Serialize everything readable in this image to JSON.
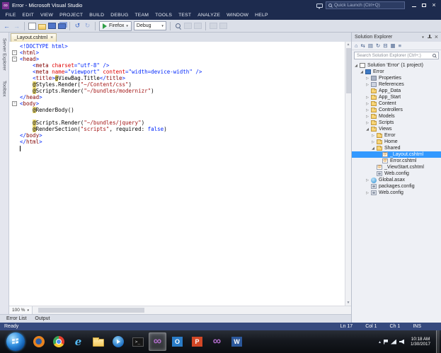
{
  "window": {
    "title": "Error - Microsoft Visual Studio",
    "quick_launch": "Quick Launch (Ctrl+Q)"
  },
  "menu": [
    "FILE",
    "EDIT",
    "VIEW",
    "PROJECT",
    "BUILD",
    "DEBUG",
    "TEAM",
    "TOOLS",
    "TEST",
    "ANALYZE",
    "WINDOW",
    "HELP"
  ],
  "toolbar": {
    "items": [
      {
        "type": "icon",
        "name": "navigate-back-icon",
        "glyph": "←"
      },
      {
        "type": "icon",
        "name": "navigate-forward-icon",
        "glyph": "→",
        "dim": true
      },
      {
        "type": "sep"
      },
      {
        "type": "icon",
        "name": "new-file-icon",
        "cls": "i-page"
      },
      {
        "type": "icon",
        "name": "open-file-icon",
        "cls": "i-folder"
      },
      {
        "type": "icon",
        "name": "save-icon",
        "cls": "i-save"
      },
      {
        "type": "icon",
        "name": "save-all-icon",
        "cls": "i-saveall"
      },
      {
        "type": "sep"
      },
      {
        "type": "icon",
        "name": "undo-icon",
        "glyph": "↺"
      },
      {
        "type": "icon",
        "name": "redo-icon",
        "glyph": "↻",
        "dim": true
      },
      {
        "type": "sep"
      },
      {
        "type": "run",
        "label": "Firefox"
      },
      {
        "type": "dropdown",
        "name": "solution-configurations-dropdown",
        "label": "Debug"
      },
      {
        "type": "sep"
      },
      {
        "type": "icon",
        "name": "find-in-files-icon",
        "cls": "i-mag"
      },
      {
        "type": "icon",
        "name": "comment-out-icon",
        "cls": "i-sq",
        "dim": true
      },
      {
        "type": "icon",
        "name": "uncomment-icon",
        "cls": "i-sq",
        "dim": true
      },
      {
        "type": "sep"
      },
      {
        "type": "icon",
        "name": "toggle-bookmark-icon",
        "cls": "i-sq",
        "dim": true
      },
      {
        "type": "icon",
        "name": "next-bookmark-icon",
        "cls": "i-sq",
        "dim": true
      }
    ]
  },
  "left_tabs": [
    "Server Explorer",
    "Toolbox"
  ],
  "editor": {
    "tab": "_Layout.cshtml",
    "zoom": "100 %",
    "code_lines": [
      {
        "tokens": [
          {
            "t": "<!DOCTYPE html>",
            "c": "b"
          }
        ]
      },
      {
        "fold": true,
        "tokens": [
          {
            "t": "<",
            "c": "b"
          },
          {
            "t": "html",
            "c": "m"
          },
          {
            "t": ">",
            "c": "b"
          }
        ]
      },
      {
        "fold": true,
        "tokens": [
          {
            "t": "<",
            "c": "b"
          },
          {
            "t": "head",
            "c": "m"
          },
          {
            "t": ">",
            "c": "b"
          }
        ]
      },
      {
        "tokens": [
          {
            "t": "    ",
            "c": "t"
          },
          {
            "t": "<",
            "c": "b"
          },
          {
            "t": "meta",
            "c": "m"
          },
          {
            "t": " ",
            "c": "t"
          },
          {
            "t": "charset",
            "c": "r"
          },
          {
            "t": "=",
            "c": "b"
          },
          {
            "t": "\"utf-8\"",
            "c": "b"
          },
          {
            "t": " ",
            "c": "t"
          },
          {
            "t": "/>",
            "c": "b"
          }
        ]
      },
      {
        "tokens": [
          {
            "t": "    ",
            "c": "t"
          },
          {
            "t": "<",
            "c": "b"
          },
          {
            "t": "meta",
            "c": "m"
          },
          {
            "t": " ",
            "c": "t"
          },
          {
            "t": "name",
            "c": "r"
          },
          {
            "t": "=",
            "c": "b"
          },
          {
            "t": "\"viewport\"",
            "c": "b"
          },
          {
            "t": " ",
            "c": "t"
          },
          {
            "t": "content",
            "c": "r"
          },
          {
            "t": "=",
            "c": "b"
          },
          {
            "t": "\"width=device-width\"",
            "c": "b"
          },
          {
            "t": " ",
            "c": "t"
          },
          {
            "t": "/>",
            "c": "b"
          }
        ]
      },
      {
        "tokens": [
          {
            "t": "    ",
            "c": "t"
          },
          {
            "t": "<",
            "c": "b"
          },
          {
            "t": "title",
            "c": "m"
          },
          {
            "t": ">",
            "c": "b"
          },
          {
            "t": "@",
            "c": "razor"
          },
          {
            "t": "ViewBag.Title",
            "c": "t"
          },
          {
            "t": "</",
            "c": "b"
          },
          {
            "t": "title",
            "c": "m"
          },
          {
            "t": ">",
            "c": "b"
          }
        ]
      },
      {
        "tokens": [
          {
            "t": "    ",
            "c": "t"
          },
          {
            "t": "@",
            "c": "razor"
          },
          {
            "t": "Styles.Render(",
            "c": "t"
          },
          {
            "t": "\"~/Content/css\"",
            "c": "s"
          },
          {
            "t": ")",
            "c": "t"
          }
        ]
      },
      {
        "tokens": [
          {
            "t": "    ",
            "c": "t"
          },
          {
            "t": "@",
            "c": "razor"
          },
          {
            "t": "Scripts.Render(",
            "c": "t"
          },
          {
            "t": "\"~/bundles/modernizr\"",
            "c": "s"
          },
          {
            "t": ")",
            "c": "t"
          }
        ]
      },
      {
        "tokens": [
          {
            "t": "</",
            "c": "b"
          },
          {
            "t": "head",
            "c": "m"
          },
          {
            "t": ">",
            "c": "b"
          }
        ]
      },
      {
        "fold": true,
        "tokens": [
          {
            "t": "<",
            "c": "b"
          },
          {
            "t": "body",
            "c": "m"
          },
          {
            "t": ">",
            "c": "b"
          }
        ]
      },
      {
        "tokens": [
          {
            "t": "    ",
            "c": "t"
          },
          {
            "t": "@",
            "c": "razor"
          },
          {
            "t": "RenderBody()",
            "c": "t"
          }
        ]
      },
      {
        "tokens": []
      },
      {
        "tokens": [
          {
            "t": "    ",
            "c": "t"
          },
          {
            "t": "@",
            "c": "razor"
          },
          {
            "t": "Scripts.Render(",
            "c": "t"
          },
          {
            "t": "\"~/bundles/jquery\"",
            "c": "s"
          },
          {
            "t": ")",
            "c": "t"
          }
        ]
      },
      {
        "tokens": [
          {
            "t": "    ",
            "c": "t"
          },
          {
            "t": "@",
            "c": "razor"
          },
          {
            "t": "RenderSection(",
            "c": "t"
          },
          {
            "t": "\"scripts\"",
            "c": "s"
          },
          {
            "t": ", required: ",
            "c": "t"
          },
          {
            "t": "false",
            "c": "k"
          },
          {
            "t": ")",
            "c": "t"
          }
        ]
      },
      {
        "tokens": [
          {
            "t": "</",
            "c": "b"
          },
          {
            "t": "body",
            "c": "m"
          },
          {
            "t": ">",
            "c": "b"
          }
        ]
      },
      {
        "tokens": [
          {
            "t": "</",
            "c": "b"
          },
          {
            "t": "html",
            "c": "m"
          },
          {
            "t": ">",
            "c": "b"
          }
        ]
      },
      {
        "caret": true,
        "tokens": []
      }
    ]
  },
  "bottom_tabs": [
    "Error List",
    "Output"
  ],
  "solution_explorer": {
    "title": "Solution Explorer",
    "search_placeholder": "Search Solution Explorer (Ctrl+;)",
    "toolbar_icons": [
      {
        "name": "home-icon",
        "glyph": "⌂"
      },
      {
        "name": "switch-views-icon",
        "glyph": "⇆"
      },
      {
        "name": "pending-changes-filter-icon",
        "glyph": "▤"
      },
      {
        "name": "sync-with-active-document-icon",
        "glyph": "↻"
      },
      {
        "name": "collapse-all-icon",
        "glyph": "⊟"
      },
      {
        "name": "show-all-files-icon",
        "glyph": "▦"
      },
      {
        "name": "properties-icon",
        "glyph": "≡"
      }
    ],
    "tree": [
      {
        "indent": 0,
        "arrow": "down",
        "icon": "solution",
        "label": "Solution 'Error' (1 project)"
      },
      {
        "indent": 1,
        "arrow": "down",
        "icon": "project",
        "label": "Error"
      },
      {
        "indent": 2,
        "arrow": "right",
        "icon": "props",
        "label": "Properties"
      },
      {
        "indent": 2,
        "arrow": "right",
        "icon": "refs",
        "label": "References"
      },
      {
        "indent": 2,
        "arrow": "",
        "icon": "folder",
        "label": "App_Data"
      },
      {
        "indent": 2,
        "arrow": "right",
        "icon": "folder",
        "label": "App_Start"
      },
      {
        "indent": 2,
        "arrow": "right",
        "icon": "folder",
        "label": "Content"
      },
      {
        "indent": 2,
        "arrow": "right",
        "icon": "folder",
        "label": "Controllers"
      },
      {
        "indent": 2,
        "arrow": "right",
        "icon": "folder",
        "label": "Models"
      },
      {
        "indent": 2,
        "arrow": "right",
        "icon": "folder",
        "label": "Scripts"
      },
      {
        "indent": 2,
        "arrow": "down",
        "icon": "folder",
        "label": "Views"
      },
      {
        "indent": 3,
        "arrow": "right",
        "icon": "folder",
        "label": "Error"
      },
      {
        "indent": 3,
        "arrow": "right",
        "icon": "folder",
        "label": "Home"
      },
      {
        "indent": 3,
        "arrow": "down",
        "icon": "folder",
        "label": "Shared"
      },
      {
        "indent": 4,
        "arrow": "",
        "icon": "cshtml",
        "label": "_Layout.cshtml",
        "selected": true
      },
      {
        "indent": 4,
        "arrow": "",
        "icon": "cshtml",
        "label": "Error.cshtml"
      },
      {
        "indent": 3,
        "arrow": "",
        "icon": "cshtml",
        "label": "_ViewStart.cshtml"
      },
      {
        "indent": 3,
        "arrow": "",
        "icon": "config",
        "label": "Web.config"
      },
      {
        "indent": 2,
        "arrow": "right",
        "icon": "asax",
        "label": "Global.asax"
      },
      {
        "indent": 2,
        "arrow": "",
        "icon": "config",
        "label": "packages.config"
      },
      {
        "indent": 2,
        "arrow": "right",
        "icon": "config",
        "label": "Web.config"
      }
    ]
  },
  "status_bar": {
    "ready": "Ready",
    "line": "Ln 17",
    "column": "Col 1",
    "char": "Ch 1",
    "mode": "INS"
  },
  "taskbar": {
    "time": "10:18 AM",
    "date": "1/30/2017",
    "apps": [
      {
        "name": "firefox-icon",
        "cls": "g-firefox"
      },
      {
        "name": "chrome-icon",
        "cls": "g-chrome"
      },
      {
        "name": "internet-explorer-icon",
        "cls": "g-ie"
      },
      {
        "name": "file-explorer-icon",
        "cls": "g-folder"
      },
      {
        "name": "media-player-icon",
        "cls": "g-media"
      },
      {
        "name": "command-prompt-icon",
        "cls": "g-cmd"
      },
      {
        "name": "visual-studio-icon",
        "cls": "g-vs",
        "active": true
      },
      {
        "name": "outlook-icon",
        "cls": "g-outlook"
      },
      {
        "name": "powerpoint-icon",
        "cls": "g-ppt"
      },
      {
        "name": "visual-studio-2-icon",
        "cls": "g-vs"
      },
      {
        "name": "word-icon",
        "cls": "g-word"
      }
    ],
    "tray": [
      {
        "name": "hidden-icons-chevron",
        "glyph": "▴"
      },
      {
        "name": "action-center-icon",
        "cls": "t-flag"
      },
      {
        "name": "network-icon",
        "cls": "t-net"
      },
      {
        "name": "volume-icon",
        "cls": "t-vol"
      }
    ]
  }
}
